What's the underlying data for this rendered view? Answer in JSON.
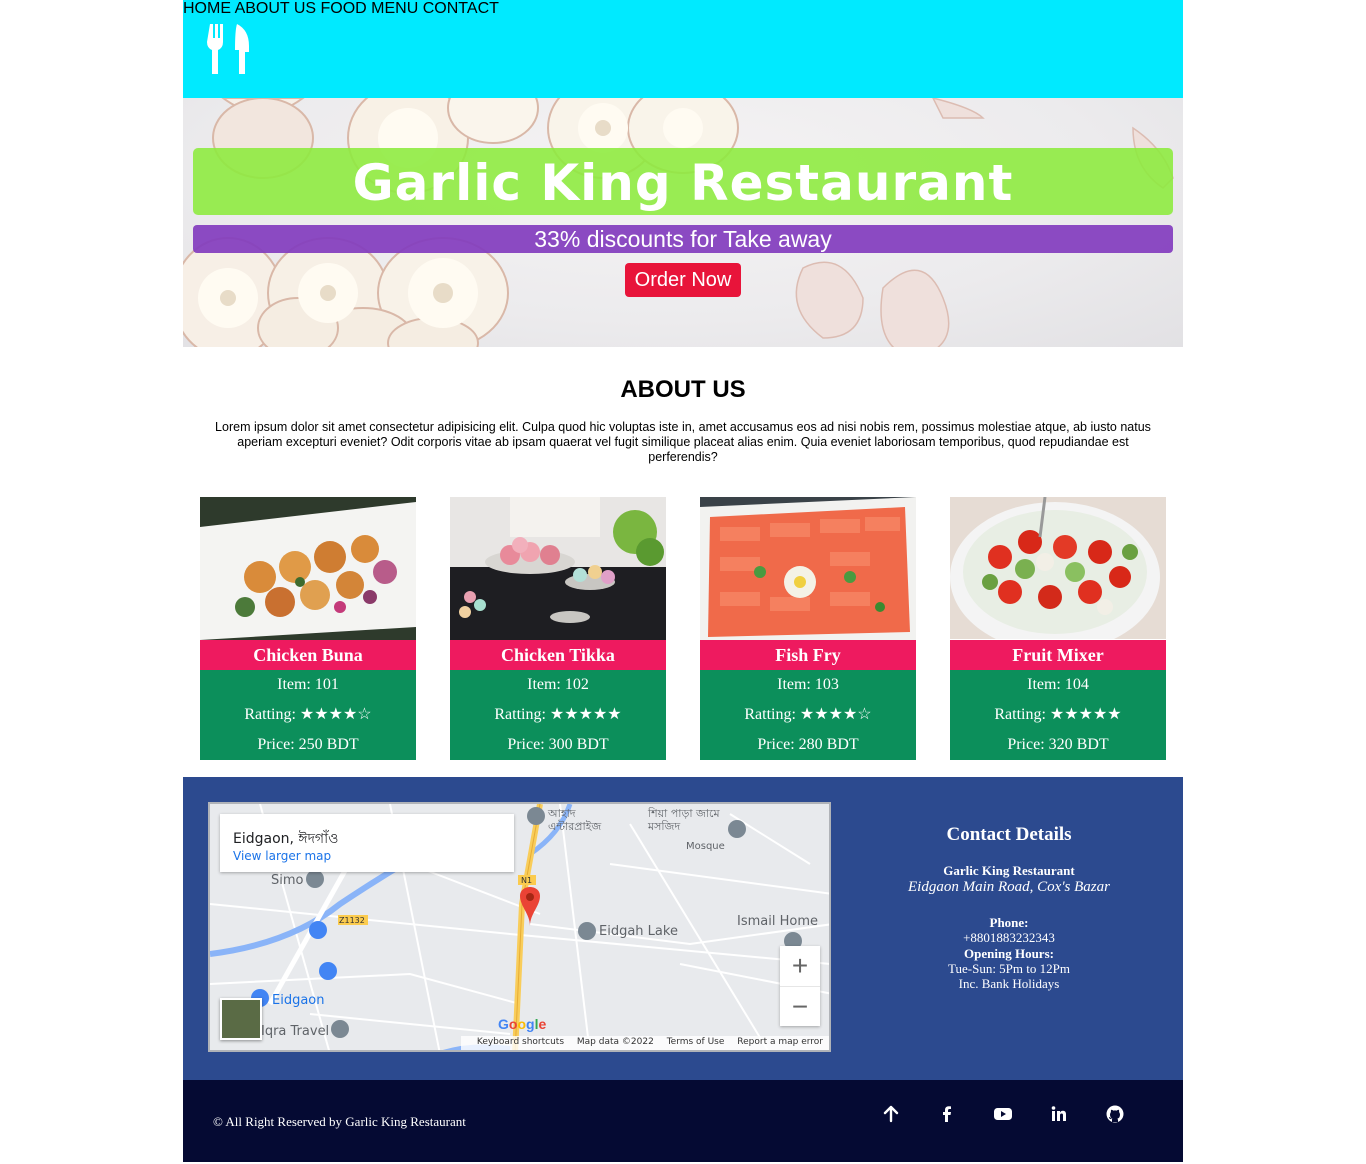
{
  "header": {
    "nav": [
      {
        "label": "HOME"
      },
      {
        "label": "ABOUT US"
      },
      {
        "label": "FOOD MENU"
      },
      {
        "label": "CONTACT"
      }
    ],
    "logo_icon": "fork-knife-icon"
  },
  "hero": {
    "title": "Garlic King Restaurant",
    "subtitle": "33% discounts for Take away",
    "cta": "Order Now"
  },
  "about": {
    "title": "ABOUT US",
    "text": "Lorem ipsum dolor sit amet consectetur adipisicing elit. Culpa quod hic voluptas iste in, amet accusamus eos ad nisi nobis rem, possimus molestiae atque, ab iusto natus aperiam excepturi eveniet? Odit corporis vitae ab ipsam quaerat vel fugit similique placeat alias enim. Quia eveniet laboriosam temporibus, quod repudiandae est perferendis?"
  },
  "menu": [
    {
      "name": "Chicken Buna",
      "item": "Item: 101",
      "rating": "Ratting: ★★★★☆",
      "price": "Price: 250 BDT"
    },
    {
      "name": "Chicken Tikka",
      "item": "Item: 102",
      "rating": "Ratting: ★★★★★",
      "price": "Price: 300 BDT"
    },
    {
      "name": "Fish Fry",
      "item": "Item: 103",
      "rating": "Ratting: ★★★★☆",
      "price": "Price: 280 BDT"
    },
    {
      "name": "Fruit Mixer",
      "item": "Item: 104",
      "rating": "Ratting: ★★★★★",
      "price": "Price: 320 BDT"
    }
  ],
  "map": {
    "place": "Eidgaon, ঈদগাঁও",
    "larger_link": "View larger map",
    "labels": [
      "Simo",
      "Eidgah Lake",
      "Ismail Home",
      "Eidgaon",
      "Iqra Travel",
      "আহাদ এন্টারপ্রাইজ",
      "শিয়া পাড়া জামে মসজিদ",
      "Mosque",
      "Z1132",
      "N1"
    ],
    "footer": [
      "Keyboard shortcuts",
      "Map data ©2022",
      "Terms of Use",
      "Report a map error"
    ],
    "google": "Google",
    "zoom_in": "+",
    "zoom_out": "−"
  },
  "contact": {
    "title": "Contact Details",
    "name": "Garlic King Restaurant",
    "address": "Eidgaon Main Road, Cox's Bazar",
    "phone_label": "Phone:",
    "phone": "+8801883232343",
    "hours_label": "Opening Hours:",
    "hours": "Tue-Sun: 5Pm to 12Pm",
    "holidays": "Inc. Bank Holidays"
  },
  "footer": {
    "copyright": "© All Right Reserved by Garlic King Restaurant",
    "icons": [
      "arrow-up-icon",
      "facebook-icon",
      "youtube-icon",
      "linkedin-icon",
      "github-icon"
    ]
  }
}
